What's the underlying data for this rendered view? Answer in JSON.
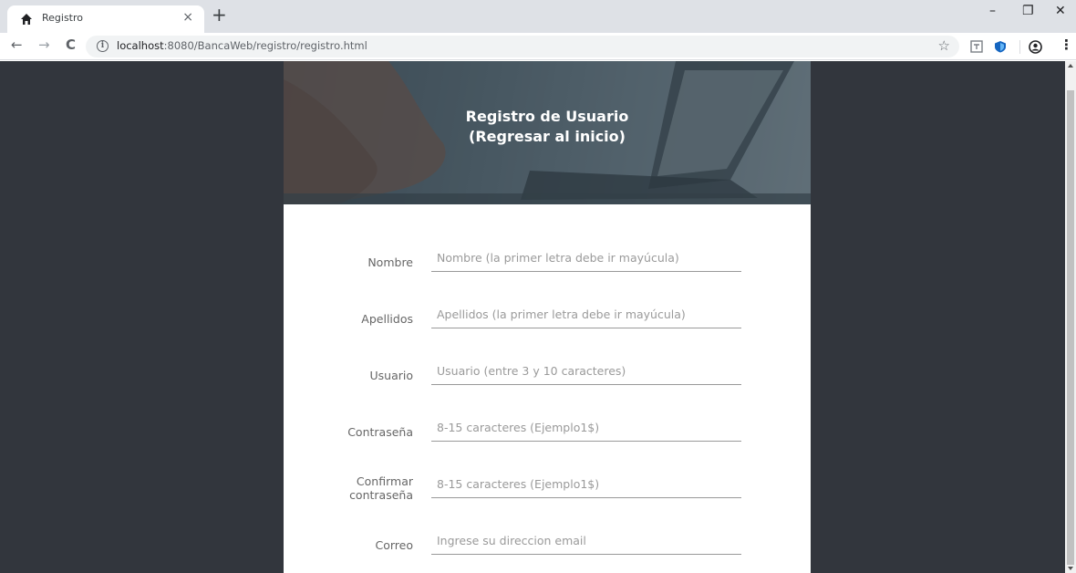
{
  "browser": {
    "tab_title": "Registro",
    "tab_close": "×",
    "new_tab": "+",
    "url_host": "localhost",
    "url_rest": ":8080/BancaWeb/registro/registro.html",
    "window": {
      "minimize": "–",
      "restore": "❐",
      "close": "✕"
    },
    "nav": {
      "back": "←",
      "forward": "→",
      "reload": "C"
    },
    "star": "☆",
    "menu": "⋮"
  },
  "header": {
    "title": "Registro de Usuario",
    "link": "(Regresar al inicio)"
  },
  "form": {
    "fields": [
      {
        "label": "Nombre",
        "placeholder": "Nombre (la primer letra debe ir mayúcula)"
      },
      {
        "label": "Apellidos",
        "placeholder": "Apellidos (la primer letra debe ir mayúcula)"
      },
      {
        "label": "Usuario",
        "placeholder": "Usuario (entre 3 y 10 caracteres)"
      },
      {
        "label": "Contraseña",
        "placeholder": "8-15 caracteres (Ejemplo1$)"
      },
      {
        "label_line1": "Confirmar",
        "label_line2": "contraseña",
        "placeholder": "8-15 caracteres (Ejemplo1$)"
      },
      {
        "label": "Correo",
        "placeholder": "Ingrese su direccion email"
      }
    ]
  },
  "colors": {
    "page_background": "#32363d",
    "card_background": "#ffffff",
    "label_text": "#666666",
    "placeholder_text": "#9a9a9a"
  }
}
